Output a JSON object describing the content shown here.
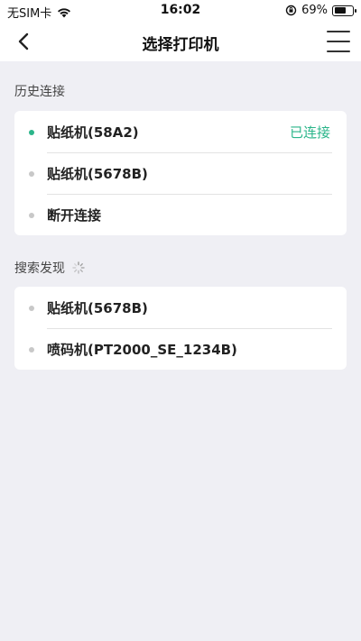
{
  "status_bar": {
    "carrier": "无SIM卡",
    "time": "16:02",
    "battery_percent": "69%",
    "battery_level": 0.69
  },
  "nav": {
    "title": "选择打印机"
  },
  "history": {
    "label": "历史连接",
    "items": [
      {
        "name": "贴纸机(58A2)",
        "status": "已连接",
        "connected": true
      },
      {
        "name": "贴纸机(5678B)",
        "status": "",
        "connected": false
      },
      {
        "name": "断开连接",
        "status": "",
        "connected": false
      }
    ]
  },
  "discover": {
    "label": "搜索发现",
    "items": [
      {
        "name": "贴纸机(5678B)"
      },
      {
        "name": "喷码机(PT2000_SE_1234B)"
      }
    ]
  },
  "colors": {
    "accent": "#2bb58a",
    "background": "#efeff4"
  }
}
